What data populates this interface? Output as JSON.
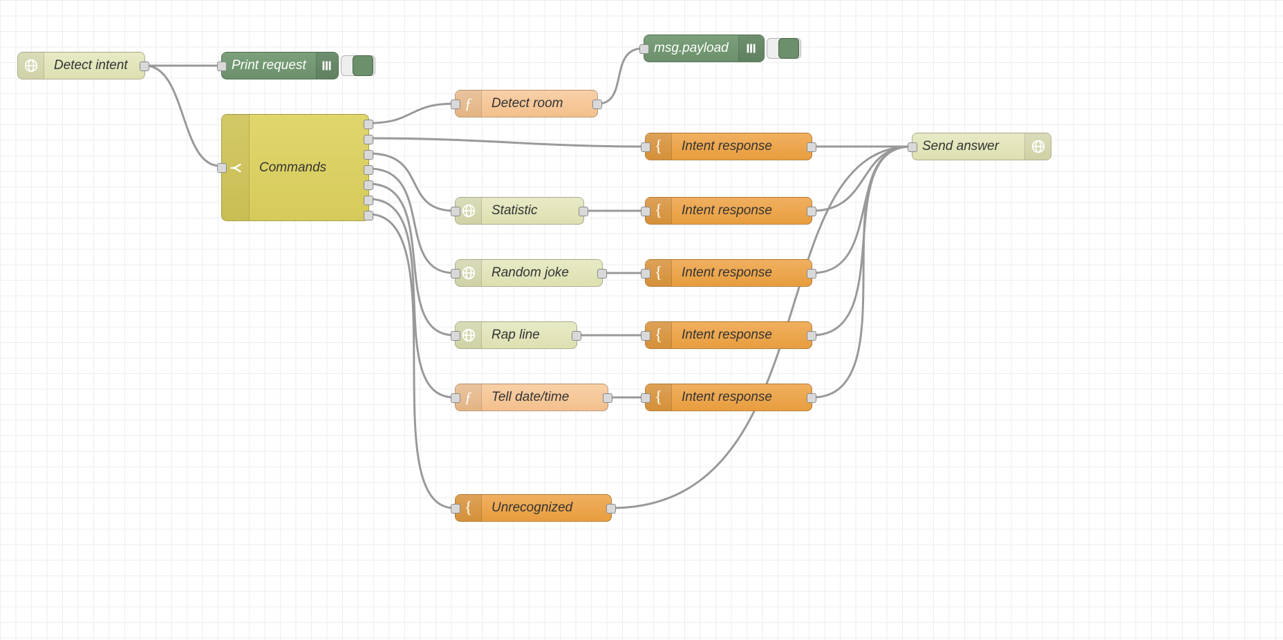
{
  "nodes": {
    "detect_intent": {
      "label": "Detect intent"
    },
    "print_request": {
      "label": "Print request"
    },
    "msg_payload": {
      "label": "msg.payload"
    },
    "commands": {
      "label": "Commands"
    },
    "detect_room": {
      "label": "Detect room"
    },
    "statistic": {
      "label": "Statistic"
    },
    "random_joke": {
      "label": "Random joke"
    },
    "rap_line": {
      "label": "Rap line"
    },
    "tell_datetime": {
      "label": "Tell date/time"
    },
    "unrecognized": {
      "label": "Unrecognized"
    },
    "intent_resp_1": {
      "label": "Intent response"
    },
    "intent_resp_2": {
      "label": "Intent response"
    },
    "intent_resp_3": {
      "label": "Intent response"
    },
    "intent_resp_4": {
      "label": "Intent response"
    },
    "intent_resp_5": {
      "label": "Intent response"
    },
    "send_answer": {
      "label": "Send answer"
    }
  },
  "colors": {
    "olive": "#e0e2b8",
    "green": "#6b906b",
    "yellow": "#d6ca5a",
    "peach": "#f3c08c",
    "orange": "#e89d3e"
  }
}
